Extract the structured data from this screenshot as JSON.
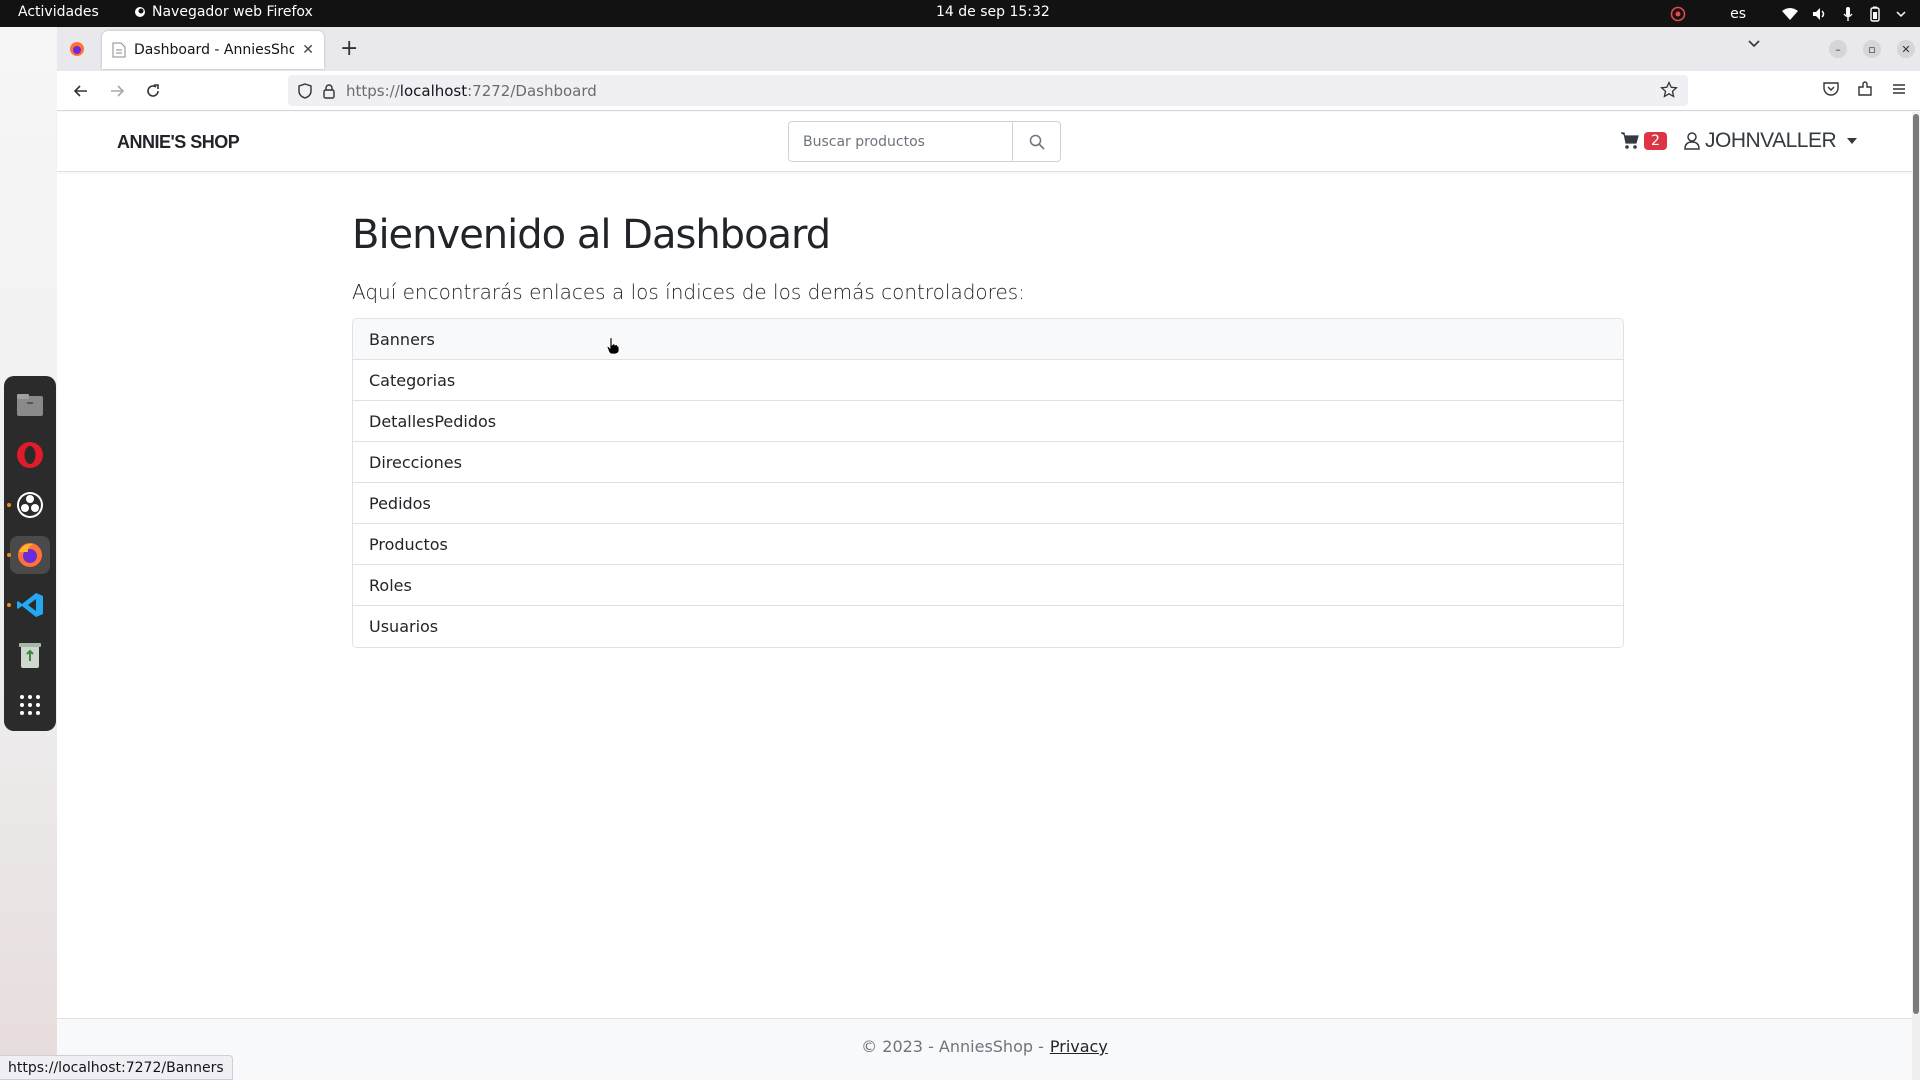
{
  "topbar": {
    "activities": "Actividades",
    "app_name": "Navegador web Firefox",
    "datetime": "14 de sep  15:32",
    "language": "es"
  },
  "browser": {
    "tab_title": "Dashboard - AnniesShop",
    "url_prefix": "https://",
    "url_host": "localhost",
    "url_rest": ":7272/Dashboard",
    "status_url": "https://localhost:7272/Banners"
  },
  "site": {
    "brand": "ANNIE'S SHOP",
    "search_placeholder": "Buscar productos",
    "cart_count": "2",
    "user_name": "JOHNVALLER"
  },
  "main": {
    "title": "Bienvenido al Dashboard",
    "lead": "Aquí encontrarás enlaces a los índices de los demás controladores:",
    "links": [
      "Banners",
      "Categorias",
      "DetallesPedidos",
      "Direcciones",
      "Pedidos",
      "Productos",
      "Roles",
      "Usuarios"
    ]
  },
  "footer": {
    "copyright": "© 2023 - AnniesShop -",
    "privacy": "Privacy"
  },
  "colors": {
    "badge": "#dc3545",
    "tabbar": "#e8e8ed",
    "topbar": "#121212"
  }
}
